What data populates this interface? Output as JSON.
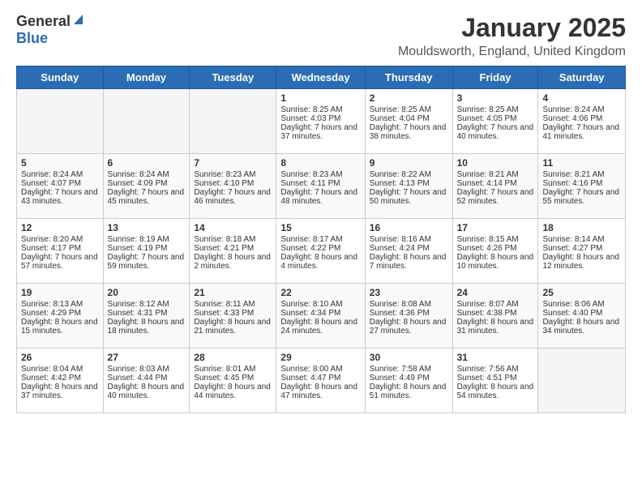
{
  "logo": {
    "general": "General",
    "blue": "Blue"
  },
  "title": "January 2025",
  "subtitle": "Mouldsworth, England, United Kingdom",
  "weekdays": [
    "Sunday",
    "Monday",
    "Tuesday",
    "Wednesday",
    "Thursday",
    "Friday",
    "Saturday"
  ],
  "weeks": [
    [
      {
        "day": "",
        "sunrise": "",
        "sunset": "",
        "daylight": ""
      },
      {
        "day": "",
        "sunrise": "",
        "sunset": "",
        "daylight": ""
      },
      {
        "day": "",
        "sunrise": "",
        "sunset": "",
        "daylight": ""
      },
      {
        "day": "1",
        "sunrise": "Sunrise: 8:25 AM",
        "sunset": "Sunset: 4:03 PM",
        "daylight": "Daylight: 7 hours and 37 minutes."
      },
      {
        "day": "2",
        "sunrise": "Sunrise: 8:25 AM",
        "sunset": "Sunset: 4:04 PM",
        "daylight": "Daylight: 7 hours and 38 minutes."
      },
      {
        "day": "3",
        "sunrise": "Sunrise: 8:25 AM",
        "sunset": "Sunset: 4:05 PM",
        "daylight": "Daylight: 7 hours and 40 minutes."
      },
      {
        "day": "4",
        "sunrise": "Sunrise: 8:24 AM",
        "sunset": "Sunset: 4:06 PM",
        "daylight": "Daylight: 7 hours and 41 minutes."
      }
    ],
    [
      {
        "day": "5",
        "sunrise": "Sunrise: 8:24 AM",
        "sunset": "Sunset: 4:07 PM",
        "daylight": "Daylight: 7 hours and 43 minutes."
      },
      {
        "day": "6",
        "sunrise": "Sunrise: 8:24 AM",
        "sunset": "Sunset: 4:09 PM",
        "daylight": "Daylight: 7 hours and 45 minutes."
      },
      {
        "day": "7",
        "sunrise": "Sunrise: 8:23 AM",
        "sunset": "Sunset: 4:10 PM",
        "daylight": "Daylight: 7 hours and 46 minutes."
      },
      {
        "day": "8",
        "sunrise": "Sunrise: 8:23 AM",
        "sunset": "Sunset: 4:11 PM",
        "daylight": "Daylight: 7 hours and 48 minutes."
      },
      {
        "day": "9",
        "sunrise": "Sunrise: 8:22 AM",
        "sunset": "Sunset: 4:13 PM",
        "daylight": "Daylight: 7 hours and 50 minutes."
      },
      {
        "day": "10",
        "sunrise": "Sunrise: 8:21 AM",
        "sunset": "Sunset: 4:14 PM",
        "daylight": "Daylight: 7 hours and 52 minutes."
      },
      {
        "day": "11",
        "sunrise": "Sunrise: 8:21 AM",
        "sunset": "Sunset: 4:16 PM",
        "daylight": "Daylight: 7 hours and 55 minutes."
      }
    ],
    [
      {
        "day": "12",
        "sunrise": "Sunrise: 8:20 AM",
        "sunset": "Sunset: 4:17 PM",
        "daylight": "Daylight: 7 hours and 57 minutes."
      },
      {
        "day": "13",
        "sunrise": "Sunrise: 8:19 AM",
        "sunset": "Sunset: 4:19 PM",
        "daylight": "Daylight: 7 hours and 59 minutes."
      },
      {
        "day": "14",
        "sunrise": "Sunrise: 8:18 AM",
        "sunset": "Sunset: 4:21 PM",
        "daylight": "Daylight: 8 hours and 2 minutes."
      },
      {
        "day": "15",
        "sunrise": "Sunrise: 8:17 AM",
        "sunset": "Sunset: 4:22 PM",
        "daylight": "Daylight: 8 hours and 4 minutes."
      },
      {
        "day": "16",
        "sunrise": "Sunrise: 8:16 AM",
        "sunset": "Sunset: 4:24 PM",
        "daylight": "Daylight: 8 hours and 7 minutes."
      },
      {
        "day": "17",
        "sunrise": "Sunrise: 8:15 AM",
        "sunset": "Sunset: 4:26 PM",
        "daylight": "Daylight: 8 hours and 10 minutes."
      },
      {
        "day": "18",
        "sunrise": "Sunrise: 8:14 AM",
        "sunset": "Sunset: 4:27 PM",
        "daylight": "Daylight: 8 hours and 12 minutes."
      }
    ],
    [
      {
        "day": "19",
        "sunrise": "Sunrise: 8:13 AM",
        "sunset": "Sunset: 4:29 PM",
        "daylight": "Daylight: 8 hours and 15 minutes."
      },
      {
        "day": "20",
        "sunrise": "Sunrise: 8:12 AM",
        "sunset": "Sunset: 4:31 PM",
        "daylight": "Daylight: 8 hours and 18 minutes."
      },
      {
        "day": "21",
        "sunrise": "Sunrise: 8:11 AM",
        "sunset": "Sunset: 4:33 PM",
        "daylight": "Daylight: 8 hours and 21 minutes."
      },
      {
        "day": "22",
        "sunrise": "Sunrise: 8:10 AM",
        "sunset": "Sunset: 4:34 PM",
        "daylight": "Daylight: 8 hours and 24 minutes."
      },
      {
        "day": "23",
        "sunrise": "Sunrise: 8:08 AM",
        "sunset": "Sunset: 4:36 PM",
        "daylight": "Daylight: 8 hours and 27 minutes."
      },
      {
        "day": "24",
        "sunrise": "Sunrise: 8:07 AM",
        "sunset": "Sunset: 4:38 PM",
        "daylight": "Daylight: 8 hours and 31 minutes."
      },
      {
        "day": "25",
        "sunrise": "Sunrise: 8:06 AM",
        "sunset": "Sunset: 4:40 PM",
        "daylight": "Daylight: 8 hours and 34 minutes."
      }
    ],
    [
      {
        "day": "26",
        "sunrise": "Sunrise: 8:04 AM",
        "sunset": "Sunset: 4:42 PM",
        "daylight": "Daylight: 8 hours and 37 minutes."
      },
      {
        "day": "27",
        "sunrise": "Sunrise: 8:03 AM",
        "sunset": "Sunset: 4:44 PM",
        "daylight": "Daylight: 8 hours and 40 minutes."
      },
      {
        "day": "28",
        "sunrise": "Sunrise: 8:01 AM",
        "sunset": "Sunset: 4:45 PM",
        "daylight": "Daylight: 8 hours and 44 minutes."
      },
      {
        "day": "29",
        "sunrise": "Sunrise: 8:00 AM",
        "sunset": "Sunset: 4:47 PM",
        "daylight": "Daylight: 8 hours and 47 minutes."
      },
      {
        "day": "30",
        "sunrise": "Sunrise: 7:58 AM",
        "sunset": "Sunset: 4:49 PM",
        "daylight": "Daylight: 8 hours and 51 minutes."
      },
      {
        "day": "31",
        "sunrise": "Sunrise: 7:56 AM",
        "sunset": "Sunset: 4:51 PM",
        "daylight": "Daylight: 8 hours and 54 minutes."
      },
      {
        "day": "",
        "sunrise": "",
        "sunset": "",
        "daylight": ""
      }
    ]
  ]
}
